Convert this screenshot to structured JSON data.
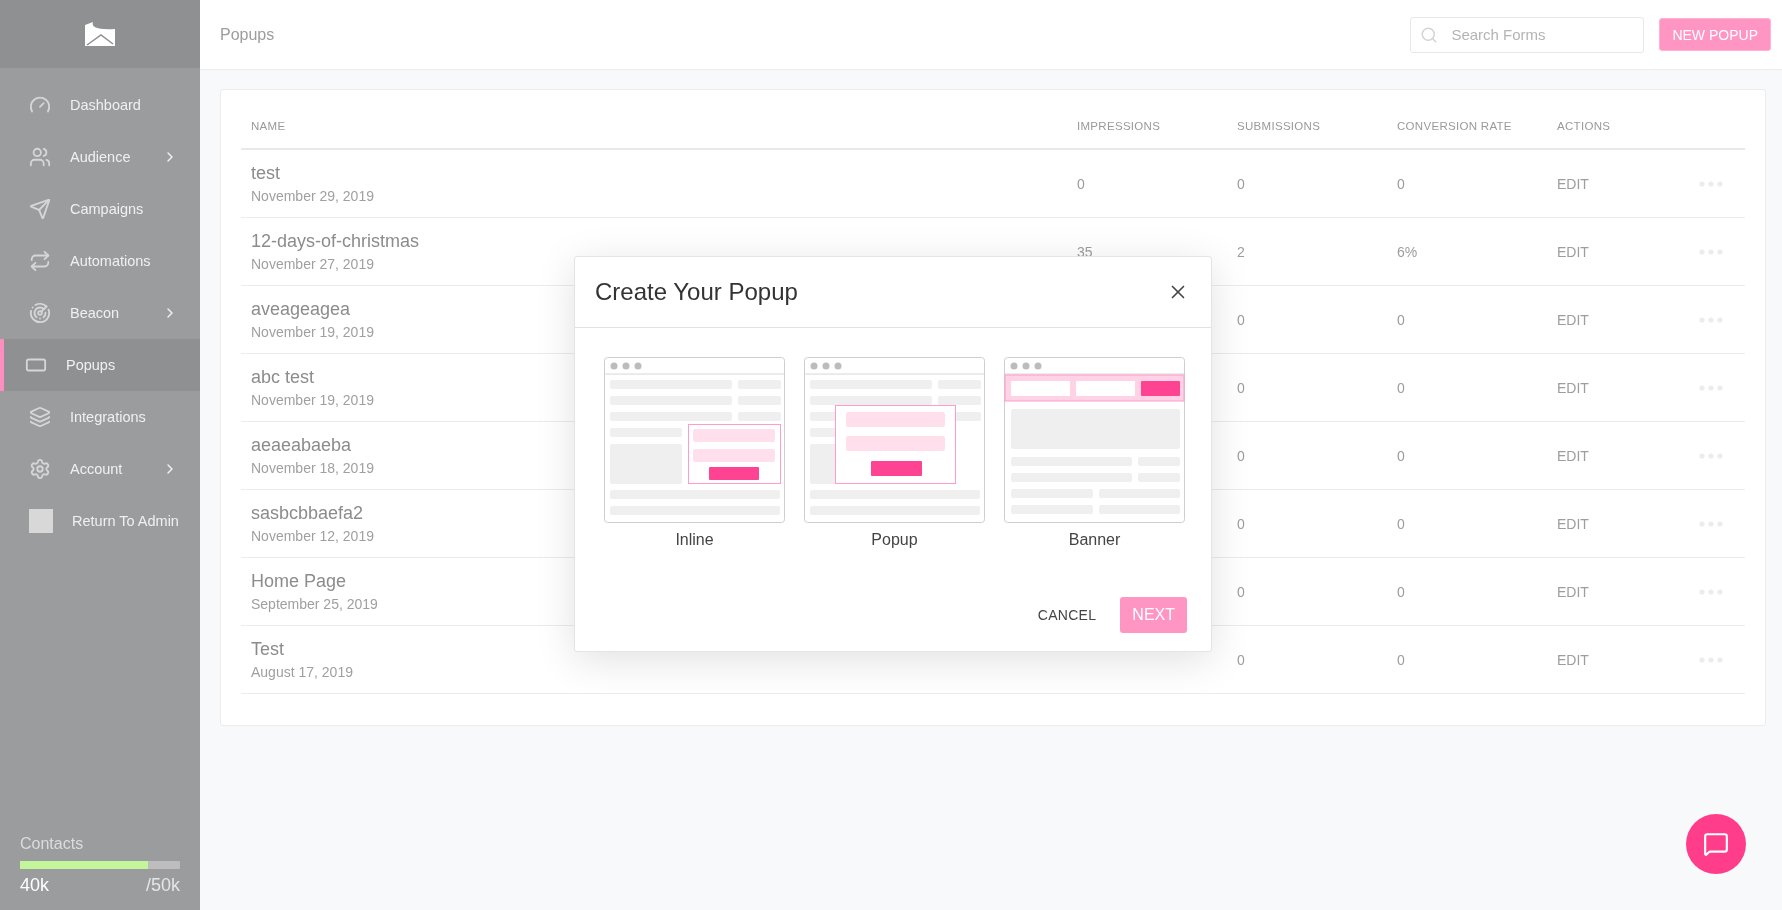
{
  "sidebar": {
    "items": [
      {
        "label": "Dashboard",
        "selected": false,
        "expandable": false
      },
      {
        "label": "Audience",
        "selected": false,
        "expandable": true
      },
      {
        "label": "Campaigns",
        "selected": false,
        "expandable": false
      },
      {
        "label": "Automations",
        "selected": false,
        "expandable": false
      },
      {
        "label": "Beacon",
        "selected": false,
        "expandable": true
      },
      {
        "label": "Popups",
        "selected": true,
        "expandable": false
      },
      {
        "label": "Integrations",
        "selected": false,
        "expandable": false
      },
      {
        "label": "Account",
        "selected": false,
        "expandable": true
      },
      {
        "label": "Return To Admin",
        "selected": false,
        "expandable": false
      }
    ],
    "contacts": {
      "label": "Contacts",
      "level": 0.8,
      "used": "40k",
      "limit": "/50k"
    }
  },
  "header": {
    "title": "Popups",
    "search": {
      "placeholder": "Search Forms"
    },
    "new_button": "NEW POPUP"
  },
  "table": {
    "columns": [
      "NAME",
      "IMPRESSIONS",
      "SUBMISSIONS",
      "CONVERSION RATE",
      "ACTIONS"
    ],
    "rows": [
      {
        "name": "test",
        "date": "November 29, 2019",
        "impressions": "0",
        "submissions": "0",
        "conversion_rate": "0",
        "action": "EDIT"
      },
      {
        "name": "12-days-of-christmas",
        "date": "November 27, 2019",
        "impressions": "35",
        "submissions": "2",
        "conversion_rate": "6%",
        "action": "EDIT"
      },
      {
        "name": "aveageagea",
        "date": "November 19, 2019",
        "submissions": "0",
        "conversion_rate": "0",
        "action": "EDIT"
      },
      {
        "name": "abc test",
        "date": "November 19, 2019",
        "submissions": "0",
        "conversion_rate": "0",
        "action": "EDIT"
      },
      {
        "name": "aeaeabaeba",
        "date": "November 18, 2019",
        "submissions": "0",
        "conversion_rate": "0",
        "action": "EDIT"
      },
      {
        "name": "sasbcbbaefa2",
        "date": "November 12, 2019",
        "submissions": "0",
        "conversion_rate": "0",
        "action": "EDIT"
      },
      {
        "name": "Home Page",
        "date": "September 25, 2019",
        "submissions": "0",
        "conversion_rate": "0",
        "action": "EDIT"
      },
      {
        "name": "Test",
        "date": "August 17, 2019",
        "submissions": "0",
        "conversion_rate": "0",
        "action": "EDIT"
      }
    ]
  },
  "dialog": {
    "title": "Create Your Popup",
    "options": [
      {
        "kind": "inline",
        "label": "Inline"
      },
      {
        "kind": "popup",
        "label": "Popup"
      },
      {
        "kind": "banner",
        "label": "Banner"
      }
    ],
    "cancel": "CANCEL",
    "next": "NEXT"
  }
}
